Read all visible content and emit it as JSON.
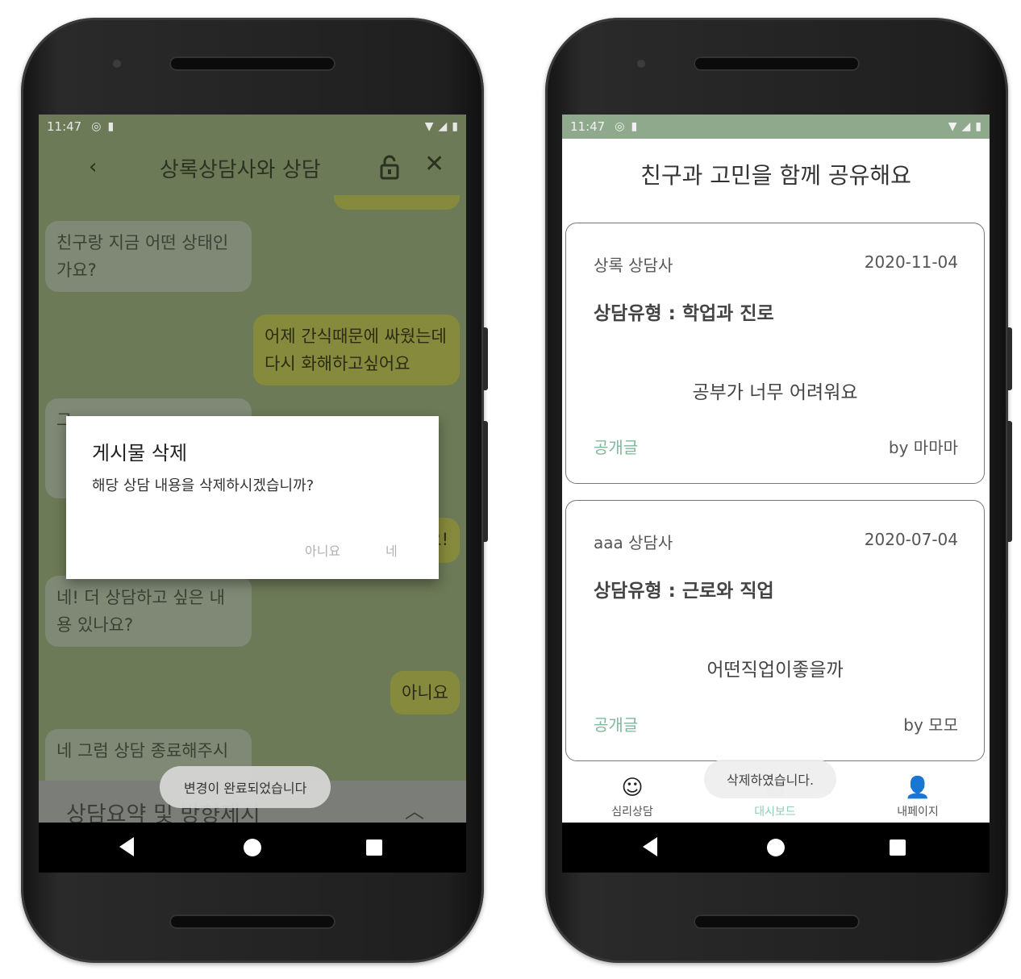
{
  "left_screen": {
    "status": {
      "time": "11:47"
    },
    "header": {
      "back_icon": "chevron-left-icon",
      "title": "상록상담사와 상담",
      "lock_icon": "lock-icon",
      "close_icon": "close-icon"
    },
    "messages": [
      {
        "side": "in",
        "text": "친구랑 지금 어떤 상태인 가요?"
      },
      {
        "side": "out",
        "text": "어제 간식때문에 싸웠는데 다시 화해하고싶어요"
      },
      {
        "side": "in",
        "text": "그"
      },
      {
        "side": "out",
        "text": "요!"
      },
      {
        "side": "in",
        "text": "네! 더 상담하고 싶은 내용 있나요?"
      },
      {
        "side": "out",
        "text": "아니요"
      },
      {
        "side": "in",
        "text": "네 그럼 상담 종료해주시"
      }
    ],
    "bottom_sheet": {
      "title": "상담요약 및 방향제시",
      "chevron_icon": "chevron-up-icon"
    },
    "dialog": {
      "title": "게시물 삭제",
      "message": "해당 상담 내용을 삭제하시겠습니까?",
      "no_label": "아니요",
      "yes_label": "네"
    },
    "toast": "변경이 완료되었습니다"
  },
  "right_screen": {
    "status": {
      "time": "11:47"
    },
    "title": "친구과 고민을 함께 공유해요",
    "posts": [
      {
        "counselor": "상록 상담사",
        "date": "2020-11-04",
        "type": "상담유형 : 학업과 진로",
        "body": "공부가 너무 어려워요",
        "visibility": "공개글",
        "author": "by 마마마"
      },
      {
        "counselor": "aaa 상담사",
        "date": "2020-07-04",
        "type": "상담유형 : 근로와 직업",
        "body": "어떤직업이좋을까",
        "visibility": "공개글",
        "author": "by 모모"
      }
    ],
    "tabs": [
      {
        "label": "심리상담",
        "icon": "smiley-icon"
      },
      {
        "label": "대시보드",
        "icon": "dashboard-icon"
      },
      {
        "label": "내페이지",
        "icon": "person-icon"
      }
    ],
    "toast": "삭제하였습니다."
  },
  "colors": {
    "chat_bg": "#6c7a57",
    "bubble_out": "#858a3c",
    "bubble_in": "#7f8975",
    "status_green": "#8fa98c",
    "accent_mint": "#7fb89c"
  }
}
